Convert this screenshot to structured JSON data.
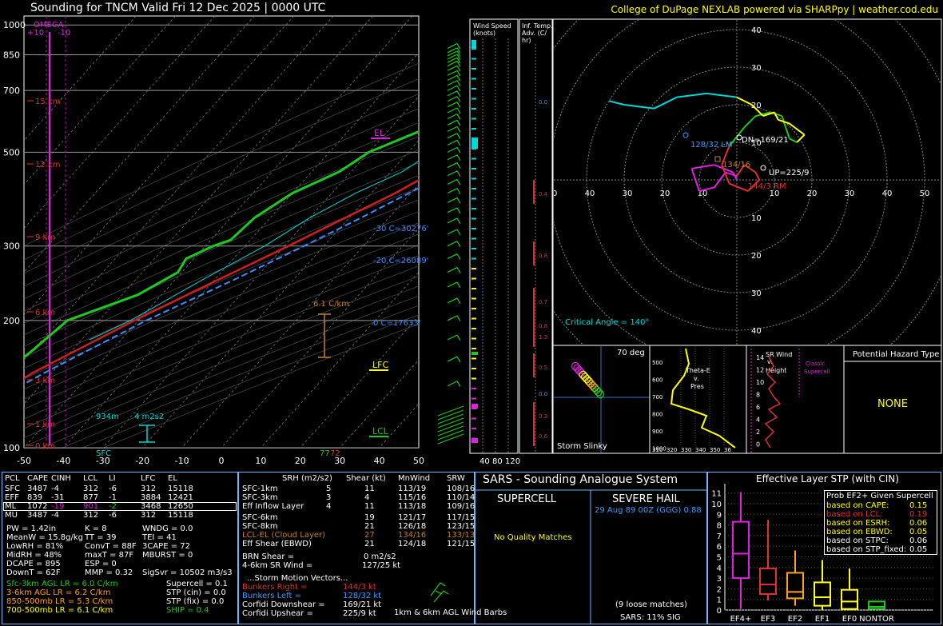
{
  "header": {
    "title": "Sounding for TNCM Valid  Fri 12 Dec 2025 | 0000 UTC",
    "credit": "College of DuPage NEXLAB powered via SHARPpy | weather.cod.edu"
  },
  "chart_data": [
    {
      "type": "line",
      "name": "skew-t",
      "pressure_ticks": [
        "100",
        "200",
        "300",
        "500",
        "700",
        "850",
        "1000"
      ],
      "temperature_ticks": [
        "-50",
        "-40",
        "-30",
        "-20",
        "-10",
        "0",
        "10",
        "20",
        "30",
        "40",
        "50"
      ],
      "xlim": [
        -50,
        50
      ],
      "ylim": [
        1050,
        100
      ],
      "height_labels": [
        "15 km",
        "12 km",
        "9 km",
        "6 km",
        "3 km",
        "1 km",
        "0 km"
      ],
      "omega_label": "OMEGA",
      "omega_ticks": [
        "+10",
        "-10"
      ],
      "levels": {
        "el": "EL",
        "lfc": "LFC",
        "lcl": "LCL",
        "m30c": "-30 C=30276'",
        "m20c": "-20 C=26089'",
        "zero_c": "0 C=17633'"
      },
      "lapse_label": "6.1 C/km",
      "depth_labels": [
        "934m",
        "4 m2s2"
      ],
      "sfc_label": "SFC",
      "sfc_temp": "77",
      "sfc_dew": "72",
      "mixing_ratio_labels": [
        "2",
        "6",
        "10",
        "14",
        "18",
        "22",
        "26",
        "30",
        "34"
      ],
      "series": [
        {
          "name": "Temperature",
          "color": "#cc2020",
          "points": [
            [
              1000,
              28
            ],
            [
              975,
              24.7
            ],
            [
              950,
              22.9
            ],
            [
              925,
              21.1
            ],
            [
              900,
              19
            ],
            [
              850,
              16
            ],
            [
              800,
              13.7
            ],
            [
              750,
              11
            ],
            [
              700,
              8
            ],
            [
              650,
              5.1
            ],
            [
              600,
              1.9
            ],
            [
              550,
              -1.2
            ],
            [
              500,
              -4.7
            ],
            [
              450,
              -9
            ],
            [
              400,
              -14
            ],
            [
              350,
              -21
            ],
            [
              300,
              -29
            ],
            [
              250,
              -39
            ],
            [
              200,
              -51
            ],
            [
              150,
              -65
            ],
            [
              100,
              -77
            ]
          ]
        },
        {
          "name": "Dewpoint",
          "color": "#1ec81e",
          "points": [
            [
              1000,
              23
            ],
            [
              975,
              19
            ],
            [
              950,
              17
            ],
            [
              925,
              16.5
            ],
            [
              900,
              16
            ],
            [
              870,
              15.8
            ],
            [
              850,
              13
            ],
            [
              820,
              2
            ],
            [
              800,
              -2
            ],
            [
              780,
              -1
            ],
            [
              740,
              -10
            ],
            [
              700,
              -7
            ],
            [
              660,
              -18
            ],
            [
              600,
              -20
            ],
            [
              560,
              -22
            ],
            [
              500,
              -30
            ],
            [
              450,
              -33
            ],
            [
              400,
              -40
            ],
            [
              350,
              -44
            ],
            [
              310,
              -45
            ],
            [
              300,
              -48
            ],
            [
              280,
              -52
            ],
            [
              260,
              -51
            ],
            [
              230,
              -56
            ],
            [
              200,
              -68
            ],
            [
              170,
              -70
            ],
            [
              150,
              -72
            ],
            [
              120,
              -73
            ],
            [
              100,
              -78
            ]
          ]
        },
        {
          "name": "Wetbulb",
          "color": "#00d8d8",
          "points": [
            [
              1000,
              24
            ],
            [
              950,
              19.5
            ],
            [
              900,
              17
            ],
            [
              850,
              14
            ],
            [
              800,
              9
            ],
            [
              750,
              6
            ],
            [
              700,
              2.5
            ],
            [
              650,
              -1
            ],
            [
              600,
              -5
            ],
            [
              550,
              -10
            ],
            [
              500,
              -14
            ],
            [
              450,
              -17
            ],
            [
              400,
              -24
            ],
            [
              350,
              -30
            ],
            [
              300,
              -35
            ],
            [
              250,
              -43
            ],
            [
              200,
              -52
            ],
            [
              180,
              -58
            ]
          ]
        },
        {
          "name": "Parcel",
          "color": "#3c8cff",
          "points": [
            [
              1000,
              28
            ],
            [
              950,
              24.5
            ],
            [
              900,
              22
            ],
            [
              850,
              20.6
            ],
            [
              800,
              18.6
            ],
            [
              750,
              16
            ],
            [
              700,
              13.4
            ],
            [
              650,
              10.5
            ],
            [
              600,
              7.2
            ],
            [
              550,
              3.6
            ],
            [
              500,
              -0.4
            ],
            [
              450,
              -5
            ],
            [
              400,
              -10.5
            ],
            [
              350,
              -17
            ],
            [
              300,
              -25
            ],
            [
              250,
              -35
            ],
            [
              200,
              -48
            ],
            [
              150,
              -62
            ],
            [
              110,
              -75
            ]
          ]
        }
      ]
    },
    {
      "type": "scatter",
      "name": "hodograph",
      "rings": [
        "10",
        "20",
        "30",
        "40",
        "50",
        "60"
      ],
      "x_ticks": [
        "70",
        "60",
        "50",
        "40",
        "30",
        "20",
        "10",
        "10",
        "20",
        "30",
        "40",
        "50",
        "60",
        "70"
      ],
      "labels": {
        "dn": "DN=169/21",
        "up": "UP=225/9",
        "lm": "128/32 LM",
        "rm": "144/3 RM",
        "mean": "134/16",
        "critical_angle": "Critical Angle = 140°"
      },
      "trace": [
        [
          0,
          0
        ],
        [
          -1,
          2
        ],
        [
          -6,
          4
        ],
        [
          -12,
          3
        ],
        [
          -10,
          -3
        ],
        [
          -6,
          -2
        ],
        [
          -3,
          2
        ],
        [
          0,
          1
        ],
        [
          2,
          4
        ],
        [
          5,
          2
        ],
        [
          6,
          0
        ],
        [
          3,
          -3
        ],
        [
          -2,
          -1
        ],
        [
          -4,
          4
        ],
        [
          -2,
          9
        ],
        [
          2,
          14
        ],
        [
          5,
          17
        ],
        [
          9,
          18
        ],
        [
          12,
          17
        ],
        [
          13,
          14
        ],
        [
          14,
          11
        ],
        [
          16,
          10
        ],
        [
          18,
          12
        ],
        [
          14,
          15
        ],
        [
          11,
          16
        ],
        [
          10,
          18
        ],
        [
          7,
          17
        ],
        [
          4,
          20
        ],
        [
          0,
          22
        ],
        [
          -8,
          23
        ],
        [
          -16,
          22
        ],
        [
          -22,
          19
        ],
        [
          -30,
          20
        ],
        [
          -34,
          21
        ]
      ]
    },
    {
      "type": "line",
      "name": "inferred-temp-advection",
      "title": "Inf. Temp. Adv. (C/hr)",
      "values": [
        "0.0",
        "0.4",
        "0.8",
        "0.7",
        "0.8",
        "1.3",
        "0.5",
        "0.0",
        "0.3",
        "0.6"
      ]
    }
  ],
  "panels": {
    "wind_speed": {
      "title": "Wind Speed (knots)",
      "ticks": [
        "40",
        "80",
        "120"
      ]
    },
    "slinky": {
      "title": "Storm Slinky",
      "angle": "70 deg"
    },
    "theta": {
      "title": "Theta-E v. Pres",
      "ticks_p": [
        "500",
        "600",
        "700",
        "800",
        "900",
        "1000"
      ],
      "ticks_t": [
        "310",
        "320",
        "330",
        "340",
        "350",
        "36"
      ]
    },
    "srwind": {
      "title": "SR Wind v. Height",
      "classic": "Classic Supercell",
      "ticks_h": [
        "14",
        "12",
        "10",
        "8",
        "6",
        "4",
        "2",
        "0"
      ]
    },
    "hazard": {
      "title": "Potential Hazard Type",
      "value": "NONE"
    }
  },
  "parcels": {
    "header": [
      "PCL",
      "CAPE",
      "CINH",
      "LCL",
      "LI",
      "LFC",
      "EL"
    ],
    "rows": [
      [
        "SFC",
        "3487",
        "-4",
        "312",
        "-6",
        "312",
        "15118"
      ],
      [
        "EFF",
        "839",
        "-31",
        "877",
        "-1",
        "3884",
        "12421"
      ],
      [
        "ML",
        "1072",
        "-19",
        "901",
        "-2",
        "3468",
        "12650"
      ],
      [
        "MU",
        "3487",
        "-4",
        "312",
        "-6",
        "312",
        "15118"
      ]
    ]
  },
  "indices": [
    [
      "PW = 1.42in",
      "K = 8",
      "WNDG = 0.0"
    ],
    [
      "MeanW = 15.8g/kg",
      "TT = 39",
      "TEI = 41"
    ],
    [
      "LowRH = 81%",
      "ConvT = 88F",
      "3CAPE = 72"
    ],
    [
      "MidRH = 48%",
      "maxT = 87F",
      "MBURST = 0"
    ],
    [
      "DCAPE = 895",
      "ESP = 0",
      ""
    ],
    [
      "DownT = 62F",
      "MMP = 0.32",
      "SigSvr = 10502 m3/s3"
    ]
  ],
  "lapse": [
    "Sfc-3km AGL LR = 6.0 C/km",
    "3-6km AGL LR = 6.2 C/km",
    "850-500mb LR = 5.3 C/km",
    "700-500mb LR = 6.1 C/km"
  ],
  "composite": [
    "Supercell = 0.1",
    "STP (cin) = 0.0",
    "STP (fix) = 0.0",
    "SHIP = 0.4"
  ],
  "kinematics": {
    "header": [
      "SRH (m2/s2)",
      "Shear (kt)",
      "MnWind",
      "SRW"
    ],
    "rows": [
      [
        "SFC-1km",
        "5",
        "11",
        "113/19",
        "108/16"
      ],
      [
        "SFC-3km",
        "3",
        "4",
        "115/16",
        "110/14"
      ],
      [
        "Eff Inflow Layer",
        "4",
        "11",
        "113/18",
        "109/16"
      ],
      [
        "SFC-6km",
        "",
        "19",
        "121/17",
        "117/15"
      ],
      [
        "SFC-8km",
        "",
        "21",
        "126/18",
        "123/15"
      ],
      [
        "LCL-EL (Cloud Layer)",
        "",
        "27",
        "134/16",
        "133/13"
      ],
      [
        "Eff Shear (EBWD)",
        "",
        "21",
        "124/18",
        "121/15"
      ]
    ],
    "brn": [
      "BRN Shear =",
      "0 m2/s2"
    ],
    "sr46": [
      "4-6km SR Wind =",
      "127/25 kt"
    ],
    "storm_header": "...Storm Motion Vectors...",
    "motions": [
      [
        "Bunkers Right =",
        "144/3 kt"
      ],
      [
        "Bunkers Left =",
        "128/32 kt"
      ],
      [
        "Corfidi Downshear =",
        "169/21 kt"
      ],
      [
        "Corfidi Upshear =",
        "225/9 kt"
      ]
    ],
    "barbs_label": "1km & 6km AGL Wind Barbs"
  },
  "sars": {
    "title": "SARS - Sounding Analogue System",
    "supercell": "SUPERCELL",
    "hail": "SEVERE HAIL",
    "match": "29 Aug 89 00Z (GGG) 0.88",
    "no_quality": "No Quality Matches",
    "loose": "(9 loose matches)",
    "sig": "SARS: 11% SIG"
  },
  "stp": {
    "title": "Effective Layer STP (with CIN)",
    "y_ticks": [
      "0",
      "1",
      "2",
      "3",
      "4",
      "5",
      "6",
      "7",
      "8",
      "9",
      "10",
      "11"
    ],
    "categories": [
      "EF4+",
      "EF3",
      "EF2",
      "EF1",
      "EF0",
      "NONTOR"
    ],
    "prob_title": "Prob EF2+ Given Supercell",
    "probs": [
      [
        "based on CAPE:",
        "0.15"
      ],
      [
        "based on LCL:",
        "0.19"
      ],
      [
        "based on ESRH:",
        "0.06"
      ],
      [
        "based on EBWD:",
        "0.05"
      ],
      [
        "based on STPC:",
        "0.06"
      ],
      [
        "based on STP_fixed:",
        "0.05"
      ]
    ]
  }
}
